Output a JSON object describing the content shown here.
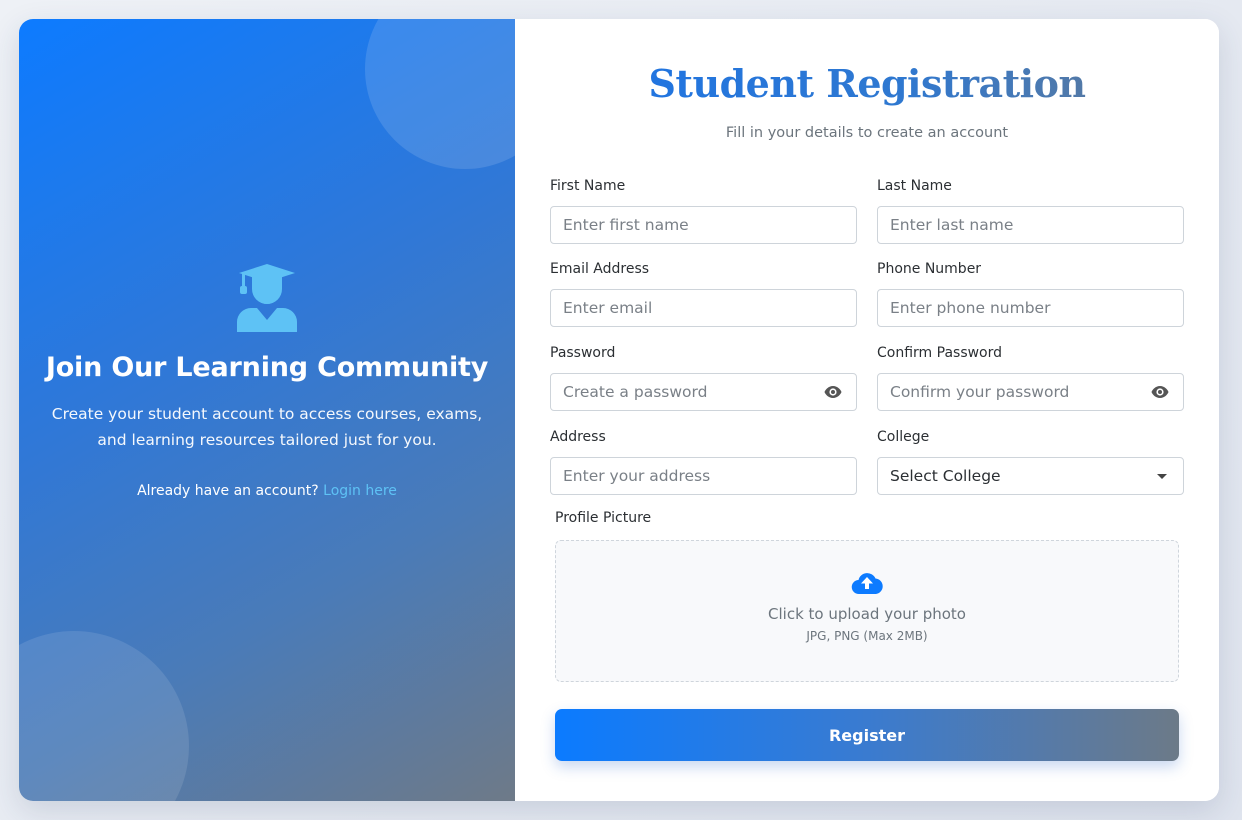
{
  "colors": {
    "primary": "#0d7bff",
    "gradient_end": "#6e7a88",
    "link": "#5ec2f5",
    "icon_light": "#5ec2f5"
  },
  "left_panel": {
    "icon": "graduate-student-icon",
    "title": "Join Our Learning Community",
    "subtitle": "Create your student account to access courses, exams, and learning resources tailored just for you.",
    "login_prompt": "Already have an account?",
    "login_link": "Login here"
  },
  "form": {
    "title": "Student Registration",
    "subtitle": "Fill in your details to create an account",
    "fields": {
      "first_name": {
        "label": "First Name",
        "placeholder": "Enter first name"
      },
      "last_name": {
        "label": "Last Name",
        "placeholder": "Enter last name"
      },
      "email": {
        "label": "Email Address",
        "placeholder": "Enter email"
      },
      "phone": {
        "label": "Phone Number",
        "placeholder": "Enter phone number"
      },
      "password": {
        "label": "Password",
        "placeholder": "Create a password",
        "icon": "eye-icon"
      },
      "confirm_password": {
        "label": "Confirm Password",
        "placeholder": "Confirm your password",
        "icon": "eye-icon"
      },
      "address": {
        "label": "Address",
        "placeholder": "Enter your address"
      },
      "college": {
        "label": "College",
        "selected": "Select College"
      }
    },
    "profile_picture": {
      "label": "Profile Picture",
      "icon": "cloud-upload-icon",
      "text": "Click to upload your photo",
      "hint": "JPG, PNG (Max 2MB)"
    },
    "register_label": "Register"
  }
}
